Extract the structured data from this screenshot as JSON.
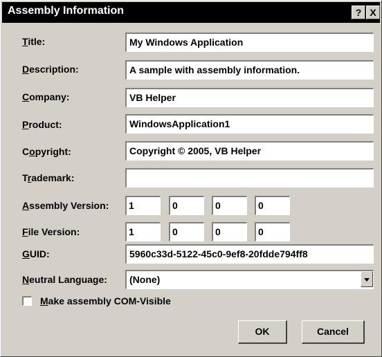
{
  "window": {
    "title": "Assembly Information",
    "help_glyph": "?",
    "close_glyph": "X"
  },
  "fields": {
    "title": {
      "label_accel": "T",
      "label_rest": "itle:",
      "value": "My Windows Application"
    },
    "description": {
      "label_accel": "D",
      "label_rest": "escription:",
      "value": "A sample with assembly information."
    },
    "company": {
      "label_accel": "C",
      "label_rest": "ompany:",
      "value": "VB Helper"
    },
    "product": {
      "label_accel": "P",
      "label_rest": "roduct:",
      "value": "WindowsApplication1"
    },
    "copyright": {
      "label_pre": "C",
      "label_accel": "o",
      "label_rest": "pyright:",
      "value": "Copyright © 2005, VB Helper"
    },
    "trademark": {
      "label_pre": "T",
      "label_accel": "r",
      "label_rest": "ademark:",
      "value": ""
    },
    "assembly_version": {
      "label_accel": "A",
      "label_rest": "ssembly Version:",
      "parts": [
        "1",
        "0",
        "0",
        "0"
      ]
    },
    "file_version": {
      "label_accel": "F",
      "label_rest": "ile Version:",
      "parts": [
        "1",
        "0",
        "0",
        "0"
      ]
    },
    "guid": {
      "label_accel": "G",
      "label_rest": "UID:",
      "value": "5960c33d-5122-45c0-9ef8-20fdde794ff8"
    },
    "neutral_language": {
      "label_accel": "N",
      "label_rest": "eutral Language:",
      "value": "(None)"
    }
  },
  "com_visible": {
    "label_accel": "M",
    "label_rest": "ake assembly COM-Visible",
    "checked": false
  },
  "buttons": {
    "ok": "OK",
    "cancel": "Cancel"
  }
}
